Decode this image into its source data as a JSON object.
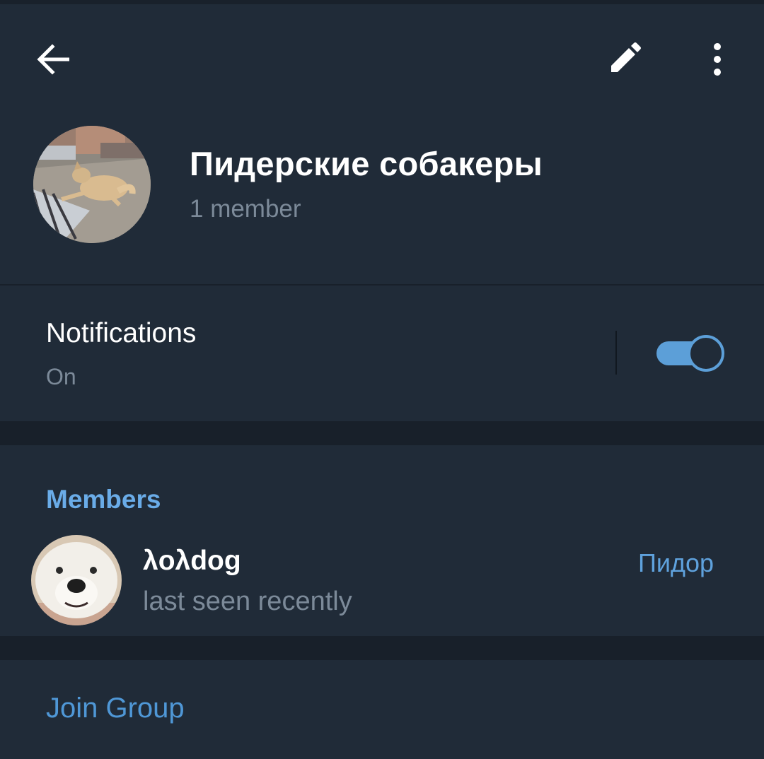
{
  "header": {
    "title": "Пидерские собакеры",
    "subtitle": "1 member"
  },
  "notifications": {
    "label": "Notifications",
    "value": "On",
    "enabled": true
  },
  "members": {
    "header": "Members",
    "items": [
      {
        "name": "λoλdog",
        "status": "last seen recently",
        "role": "Пидор"
      }
    ]
  },
  "actions": {
    "join_label": "Join Group"
  },
  "colors": {
    "background": "#202b38",
    "accent": "#5c9fd8",
    "text_secondary": "#7c8a99"
  }
}
